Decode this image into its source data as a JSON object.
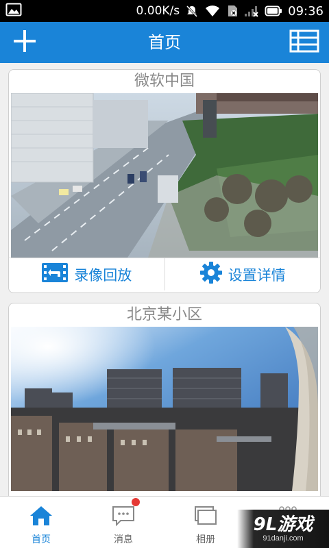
{
  "status_bar": {
    "speed": "0.00K/s",
    "time": "09:36",
    "icons": [
      "image-icon",
      "mute-icon",
      "wifi-icon",
      "sim-icon",
      "signal-icon",
      "battery-icon"
    ]
  },
  "header": {
    "title": "首页",
    "add_icon": "plus-icon",
    "menu_icon": "list-view-icon"
  },
  "cameras": [
    {
      "name": "微软中国",
      "actions": {
        "playback_label": "录像回放",
        "settings_label": "设置详情"
      }
    },
    {
      "name": "北京某小区"
    }
  ],
  "bottom_nav": {
    "items": [
      {
        "label": "首页",
        "icon": "home-icon",
        "active": true
      },
      {
        "label": "消息",
        "icon": "message-icon",
        "badge": true
      },
      {
        "label": "相册",
        "icon": "album-icon"
      },
      {
        "label": "",
        "icon": "more-icon"
      }
    ]
  },
  "watermark": {
    "main": "9L游戏",
    "sub": "91danji.com"
  },
  "colors": {
    "primary": "#1a84d8",
    "badge": "#e53935",
    "title_gray": "#888888"
  }
}
